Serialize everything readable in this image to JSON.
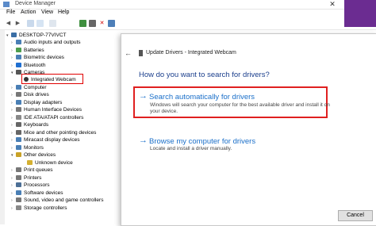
{
  "window": {
    "title": "Device Manager",
    "close_glyph": "✕"
  },
  "menu": [
    "File",
    "Action",
    "View",
    "Help"
  ],
  "toolbar": {
    "buttons": [
      "back-icon",
      "forward-icon",
      "properties-icon",
      "help-icon",
      "monitor-icon",
      "update-driver-icon",
      "disable-icon",
      "uninstall-icon",
      "scan-icon"
    ]
  },
  "tree": {
    "root": "DESKTOP-77VIVCT",
    "items": [
      "Audio inputs and outputs",
      "Batteries",
      "Biometric devices",
      "Bluetooth",
      "Cameras",
      "Integrated Webcam",
      "Computer",
      "Disk drives",
      "Display adapters",
      "Human Interface Devices",
      "IDE ATA/ATAPI controllers",
      "Keyboards",
      "Mice and other pointing devices",
      "Miracast display devices",
      "Monitors",
      "Other devices",
      "Unknown device",
      "Print queues",
      "Printers",
      "Processors",
      "Software devices",
      "Sound, video and game controllers",
      "Storage controllers"
    ]
  },
  "dialog": {
    "back_glyph": "←",
    "title": "Update Drivers - Integrated Webcam",
    "heading": "How do you want to search for drivers?",
    "option1": {
      "arrow": "→",
      "title": "Search automatically for drivers",
      "description": "Windows will search your computer for the best available driver and install it on your device."
    },
    "option2": {
      "arrow": "→",
      "title": "Browse my computer for drivers",
      "description": "Locate and install a driver manually."
    },
    "cancel_label": "Cancel"
  },
  "colors": {
    "link_blue": "#1a6fc9",
    "heading_blue": "#1a3e8c",
    "highlight_red": "#e02020",
    "purple": "#6b2c91"
  }
}
